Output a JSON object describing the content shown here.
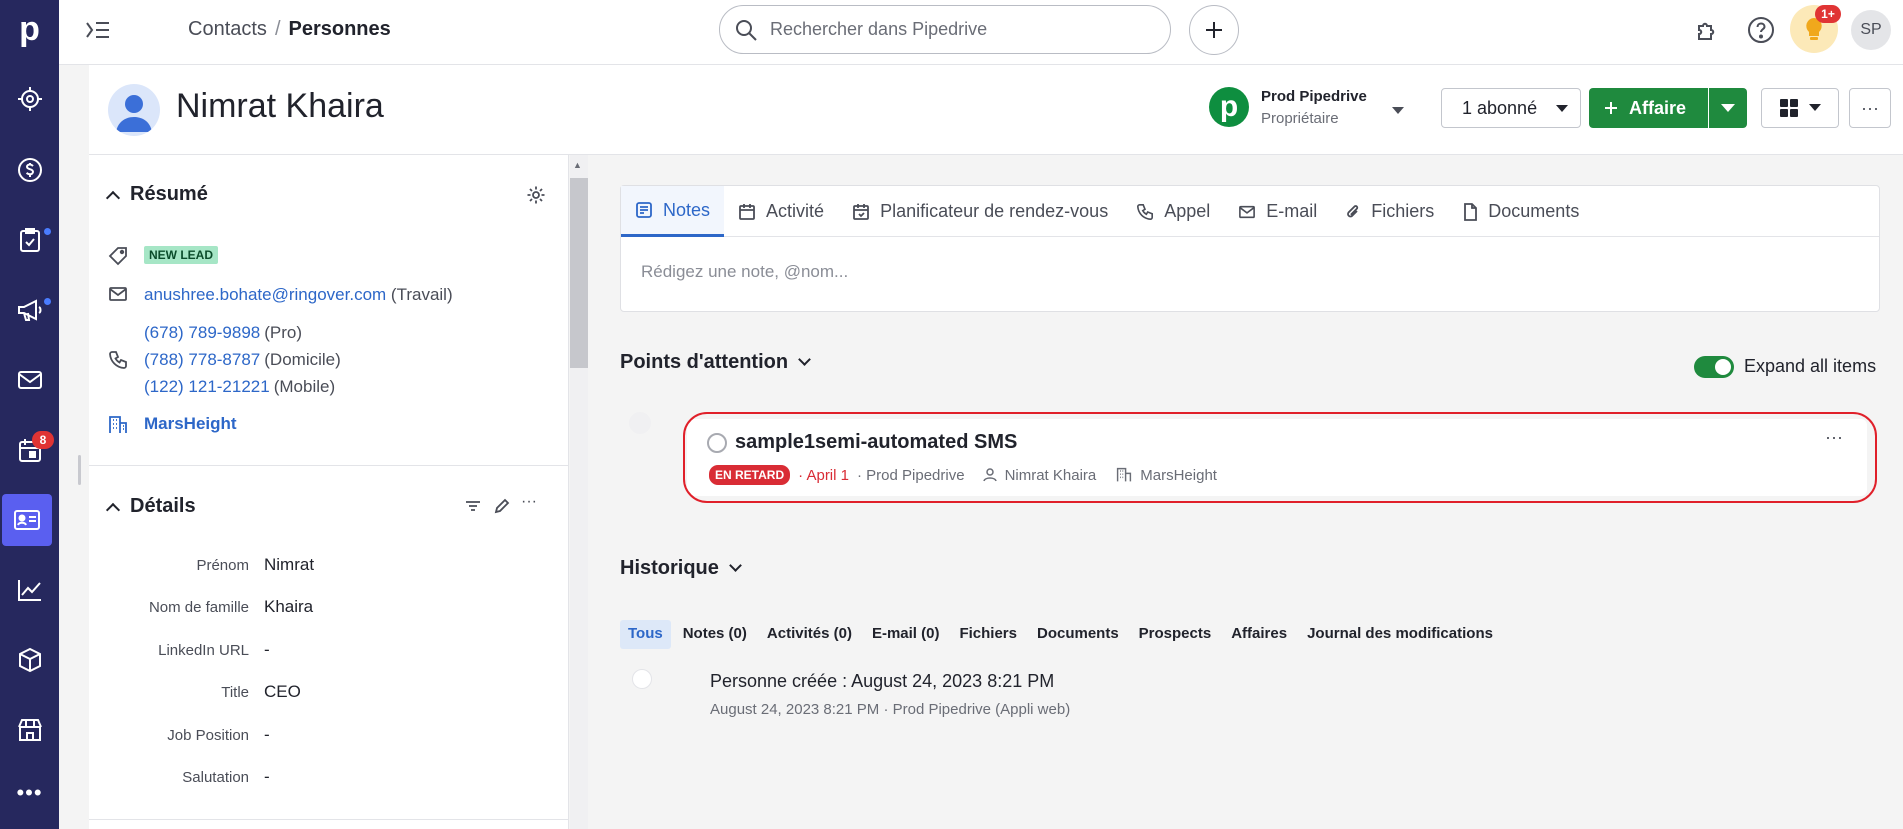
{
  "nav": {
    "logo": "p",
    "items": [
      {
        "name": "focus",
        "icon": "target-icon"
      },
      {
        "name": "deals",
        "icon": "dollar-icon"
      },
      {
        "name": "activities",
        "icon": "checklist-icon",
        "dot": true
      },
      {
        "name": "campaigns",
        "icon": "megaphone-icon",
        "dot": true
      },
      {
        "name": "mail",
        "icon": "mail-icon"
      },
      {
        "name": "calendar",
        "icon": "calendar-icon",
        "badge": "8"
      },
      {
        "name": "contacts",
        "icon": "contact-card-icon",
        "active": true
      },
      {
        "name": "insights",
        "icon": "chart-icon"
      },
      {
        "name": "products",
        "icon": "box-icon"
      },
      {
        "name": "marketplace",
        "icon": "store-icon"
      }
    ],
    "more": "•••"
  },
  "topbar": {
    "breadcrumb_parent": "Contacts",
    "breadcrumb_sep": "/",
    "breadcrumb_current": "Personnes",
    "search_placeholder": "Rechercher dans Pipedrive",
    "notif_badge": "1+",
    "user_initials": "SP"
  },
  "person": {
    "name": "Nimrat Khaira",
    "owner_name": "Prod Pipedrive",
    "owner_role": "Propriétaire",
    "owner_logo": "p",
    "follow_label": "1 abonné",
    "deal_label": "Affaire",
    "more_label": "···"
  },
  "summary": {
    "title": "Résumé",
    "label_badge": "NEW LEAD",
    "email": "anushree.bohate@ringover.com",
    "email_type": "(Travail)",
    "phones": [
      {
        "number": "(678) 789-9898",
        "type": "(Pro)"
      },
      {
        "number": "(788) 778-8787",
        "type": "(Domicile)"
      },
      {
        "number": "(122) 121-21221",
        "type": "(Mobile)"
      }
    ],
    "organization": "MarsHeight"
  },
  "details": {
    "title": "Détails",
    "more_label": "···",
    "fields": [
      {
        "label": "Prénom",
        "value": "Nimrat"
      },
      {
        "label": "Nom de famille",
        "value": "Khaira"
      },
      {
        "label": "LinkedIn URL",
        "value": "-"
      },
      {
        "label": "Title",
        "value": "CEO"
      },
      {
        "label": "Job Position",
        "value": "-"
      },
      {
        "label": "Salutation",
        "value": "-"
      }
    ]
  },
  "composer": {
    "tabs": [
      {
        "label": "Notes",
        "icon": "note-icon",
        "active": true
      },
      {
        "label": "Activité",
        "icon": "calendar-icon"
      },
      {
        "label": "Planificateur de rendez-vous",
        "icon": "scheduler-icon"
      },
      {
        "label": "Appel",
        "icon": "phone-icon"
      },
      {
        "label": "E-mail",
        "icon": "mail-icon"
      },
      {
        "label": "Fichiers",
        "icon": "paperclip-icon"
      },
      {
        "label": "Documents",
        "icon": "document-icon"
      }
    ],
    "placeholder": "Rédigez une note, @nom..."
  },
  "focus": {
    "title": "Points d'attention",
    "expand_label": "Expand all items",
    "expand_on": true,
    "item": {
      "title": "sample1semi-automated SMS",
      "status": "EN RETARD",
      "date": "April 1",
      "owner": "Prod Pipedrive",
      "person": "Nimrat Khaira",
      "org": "MarsHeight",
      "more_label": "···"
    }
  },
  "history": {
    "title": "Historique",
    "tabs": [
      {
        "label": "Tous",
        "active": true
      },
      {
        "label": "Notes (0)"
      },
      {
        "label": "Activités (0)"
      },
      {
        "label": "E-mail (0)"
      },
      {
        "label": "Fichiers"
      },
      {
        "label": "Documents"
      },
      {
        "label": "Prospects"
      },
      {
        "label": "Affaires"
      },
      {
        "label": "Journal des modifications"
      }
    ],
    "entry_title": "Personne créée : August 24, 2023 8:21 PM",
    "entry_sub": "August 24, 2023 8:21 PM · Prod Pipedrive (Appli web)"
  },
  "colors": {
    "nav_bg": "#26285e",
    "nav_active": "#5a5ff0",
    "brand_green": "#1f8a3e",
    "link_blue": "#2d67c8",
    "late_red": "#d92c35"
  }
}
